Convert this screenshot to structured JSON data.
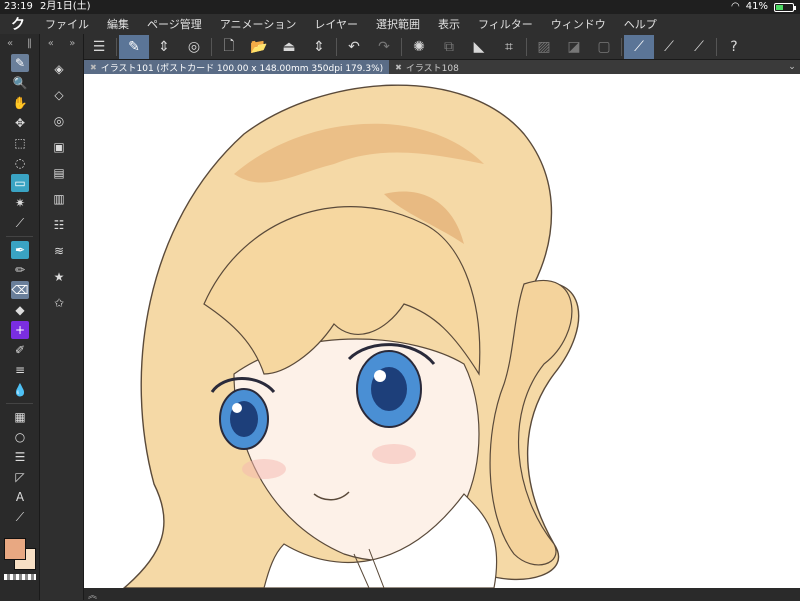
{
  "status": {
    "time": "23:19",
    "date": "2月1日(土)",
    "battery": "41%",
    "battery_level": 0.41
  },
  "menu": {
    "logo": "ク",
    "items": [
      "ファイル",
      "編集",
      "ページ管理",
      "アニメーション",
      "レイヤー",
      "選択範囲",
      "表示",
      "フィルター",
      "ウィンドウ",
      "ヘルプ"
    ]
  },
  "strip": {
    "collapse": "«",
    "handle": "‖",
    "expand": "»"
  },
  "tools": [
    {
      "name": "brush-icon",
      "glyph": "✎"
    },
    {
      "name": "zoom-icon",
      "glyph": "🔍"
    },
    {
      "name": "hand-icon",
      "glyph": "✋"
    },
    {
      "name": "move-icon",
      "glyph": "✥"
    },
    {
      "name": "object-select-icon",
      "glyph": "⬚"
    },
    {
      "name": "lasso-icon",
      "glyph": "◌"
    },
    {
      "name": "selection-icon",
      "glyph": "▭"
    },
    {
      "name": "magic-wand-icon",
      "glyph": "✷"
    },
    {
      "name": "eyedropper-icon",
      "glyph": "⟋"
    },
    {
      "name": "pen-icon",
      "glyph": "✒"
    },
    {
      "name": "pencil-icon",
      "glyph": "✏"
    },
    {
      "name": "eraser-icon",
      "glyph": "⌫"
    },
    {
      "name": "fill-icon",
      "glyph": "◆"
    },
    {
      "name": "blend-icon",
      "glyph": "+"
    },
    {
      "name": "marker-icon",
      "glyph": "✐"
    },
    {
      "name": "airbrush-icon",
      "glyph": "≡"
    },
    {
      "name": "water-drop-icon",
      "glyph": "💧"
    },
    {
      "name": "gradient-icon",
      "glyph": "▦"
    },
    {
      "name": "ellipse-icon",
      "glyph": "○"
    },
    {
      "name": "frame-icon",
      "glyph": "☰"
    },
    {
      "name": "ruler-icon",
      "glyph": "◸"
    },
    {
      "name": "text-icon",
      "glyph": "A"
    },
    {
      "name": "correct-line-icon",
      "glyph": "⟋"
    }
  ],
  "sub_tools": [
    {
      "name": "layer-property-icon",
      "glyph": "◈"
    },
    {
      "name": "layer-fill-icon",
      "glyph": "◇"
    },
    {
      "name": "layer-mask-icon",
      "glyph": "◎"
    },
    {
      "name": "navigator-icon",
      "glyph": "▣"
    },
    {
      "name": "color-wheel-icon",
      "glyph": "▤"
    },
    {
      "name": "filmstrip-icon",
      "glyph": "▥"
    },
    {
      "name": "layer-stack-icon",
      "glyph": "☷"
    },
    {
      "name": "layers-icon",
      "glyph": "≋"
    },
    {
      "name": "material-icon",
      "glyph": "★"
    },
    {
      "name": "favorite-icon",
      "glyph": "✩"
    }
  ],
  "commands": [
    {
      "name": "menu-icon",
      "glyph": "☰"
    },
    {
      "name": "canvas-edit-icon",
      "glyph": "✎",
      "active": true
    },
    {
      "name": "stepper-icon",
      "glyph": "⇕"
    },
    {
      "name": "swirl-icon",
      "glyph": "◎"
    },
    {
      "name": "new-file-icon",
      "glyph": "🗋"
    },
    {
      "name": "open-folder-icon",
      "glyph": "📂"
    },
    {
      "name": "save-icon",
      "glyph": "⏏"
    },
    {
      "name": "stepper-2-icon",
      "glyph": "⇕"
    },
    {
      "name": "undo-icon",
      "glyph": "↶"
    },
    {
      "name": "redo-icon",
      "glyph": "↷",
      "dim": true
    },
    {
      "name": "loading-icon",
      "glyph": "✺"
    },
    {
      "name": "copy-icon",
      "glyph": "⧉",
      "dim": true
    },
    {
      "name": "fill-bucket-icon",
      "glyph": "◣"
    },
    {
      "name": "crop-icon",
      "glyph": "⌗"
    },
    {
      "name": "clear-outside-icon",
      "glyph": "▨",
      "dim": true
    },
    {
      "name": "invert-icon",
      "glyph": "◪",
      "dim": true
    },
    {
      "name": "selection-frame-icon",
      "glyph": "▢",
      "dim": true
    },
    {
      "name": "brush-stroke-active-icon",
      "glyph": "⟋",
      "active": true
    },
    {
      "name": "brush-stroke-icon",
      "glyph": "⟋"
    },
    {
      "name": "brush-stroke-2-icon",
      "glyph": "⟋"
    },
    {
      "name": "help-icon",
      "glyph": "?"
    }
  ],
  "tabs": [
    {
      "label": "イラスト101 (ポストカード 100.00 x 148.00mm 350dpi 179.3%)",
      "active": true
    },
    {
      "label": "イラスト108",
      "active": false
    }
  ],
  "tab_close": "✖",
  "colors": {
    "main": "#e8a882",
    "sub": "#f7dfc4",
    "accent": "#5b7597"
  }
}
